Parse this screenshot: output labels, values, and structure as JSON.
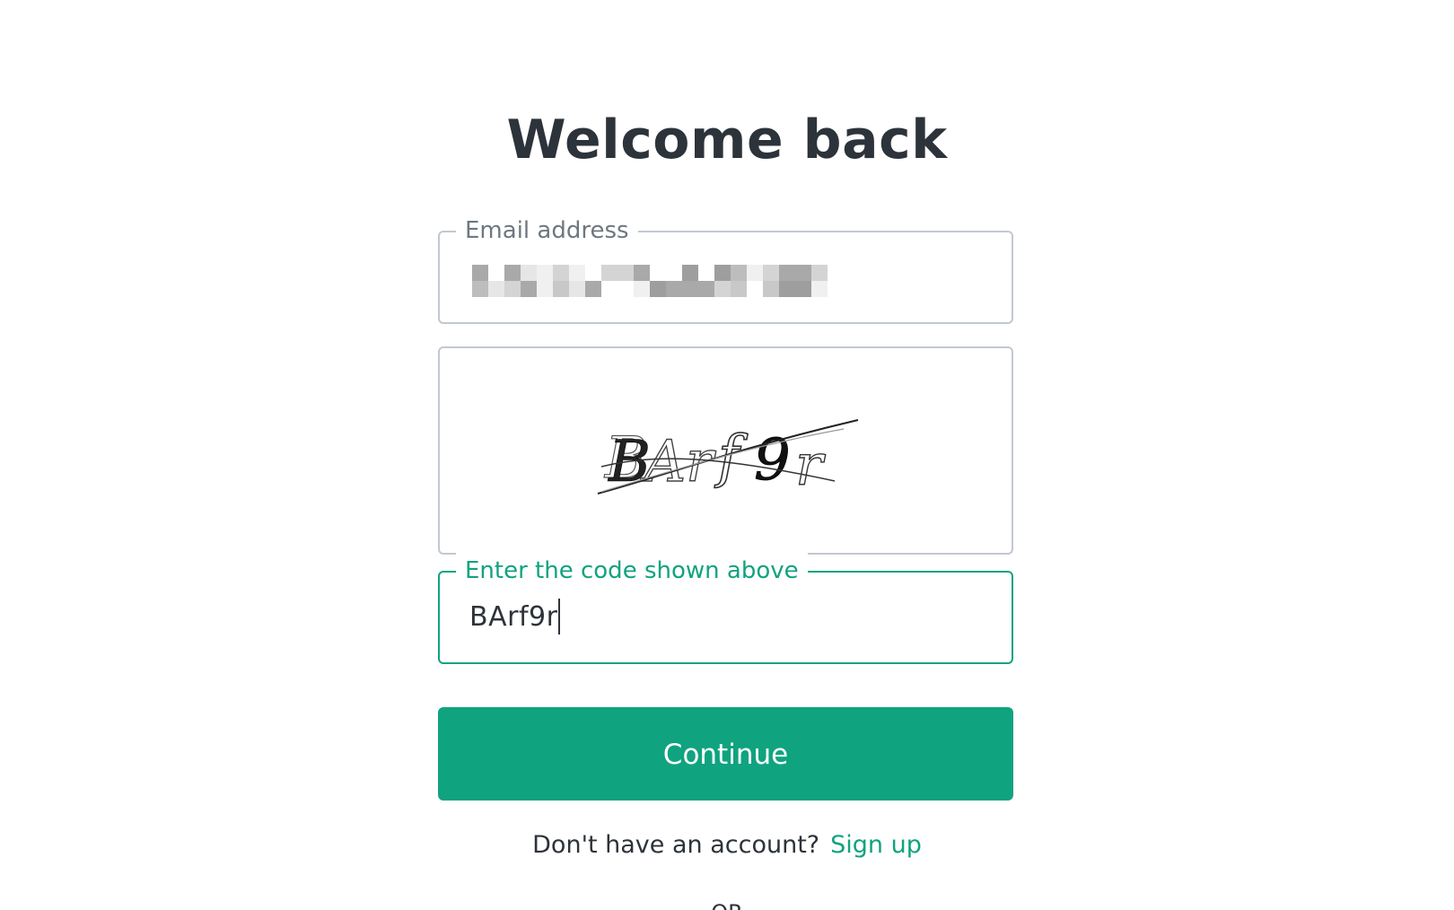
{
  "page": {
    "title": "Welcome back"
  },
  "email": {
    "label": "Email address",
    "value_obscured": true
  },
  "captcha": {
    "text": "BArf9r"
  },
  "code_field": {
    "label": "Enter the code shown above",
    "value": "BArf9r"
  },
  "continue_button": {
    "label": "Continue"
  },
  "signup": {
    "prompt": "Don't have an account?",
    "link_label": "Sign up"
  },
  "or_divider": {
    "label": "OR"
  },
  "colors": {
    "accent": "#10a37f",
    "text": "#2d333a",
    "border": "#c2c8d0",
    "label": "#6f7780"
  }
}
